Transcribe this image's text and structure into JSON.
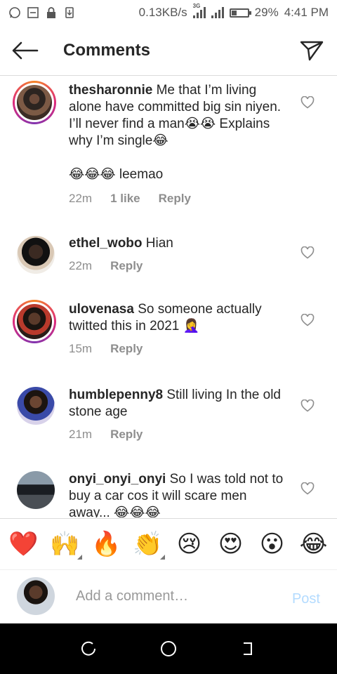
{
  "status_bar": {
    "speed": "0.13KB/s",
    "network_tag": "3G",
    "battery": "29%",
    "time": "4:41 PM"
  },
  "header": {
    "title": "Comments"
  },
  "comments": [
    {
      "username": "thesharonnie",
      "text": "Me that I’m living alone have committed big sin niyen. I’ll never find a man😭😭 Explains why I’m single😂",
      "reply_line": "😂😂😂 leemao",
      "time": "22m",
      "likes": "1 like",
      "reply": "Reply"
    },
    {
      "username": "ethel_wobo",
      "text": "Hian",
      "time": "22m",
      "reply": "Reply"
    },
    {
      "username": "ulovenasa",
      "text": "So someone actually twitted this in 2021 🤦‍♀️",
      "time": "15m",
      "reply": "Reply"
    },
    {
      "username": "humblepenny8",
      "text": "Still living In the old stone age",
      "time": "21m",
      "reply": "Reply"
    },
    {
      "username": "onyi_onyi_onyi",
      "text": "So I was told not to buy a car cos it will scare men away... 😂😂😂"
    }
  ],
  "emoji_bar": [
    "❤️",
    "🙌",
    "🔥",
    "👏",
    "😢",
    "😍",
    "😮",
    "😂"
  ],
  "add_comment": {
    "placeholder": "Add a comment…",
    "post_label": "Post"
  },
  "colors": {
    "accent_post": "#b3dbff",
    "muted_text": "#8e8e8e"
  }
}
